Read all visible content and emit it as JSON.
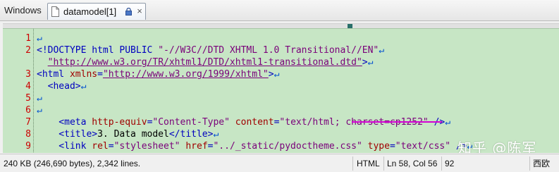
{
  "tabbar": {
    "group_label": "Windows",
    "tab": {
      "label": "datamodel[1]",
      "icon": "document-icon",
      "lock_icon": "lock-icon",
      "close_icon": "close-icon",
      "close_glyph": "×"
    }
  },
  "editor": {
    "lines": [
      {
        "number": "1",
        "tokens": []
      },
      {
        "number": "2",
        "tokens": [
          {
            "t": "<!DOCTYPE html PUBLIC ",
            "c": "tag"
          },
          {
            "t": "\"-//W3C//DTD XHTML 1.0 Transitional//EN\"",
            "c": "str"
          }
        ]
      },
      {
        "number": "",
        "tokens": [
          {
            "t": "  ",
            "c": "txt"
          },
          {
            "t": "\"http://www.w3.org/TR/xhtml1/DTD/xhtml1-transitional.dtd\"",
            "c": "str",
            "link": true
          },
          {
            "t": ">",
            "c": "tag"
          }
        ]
      },
      {
        "number": "3",
        "tokens": [
          {
            "t": "<html ",
            "c": "tag"
          },
          {
            "t": "xmlns",
            "c": "attr"
          },
          {
            "t": "=",
            "c": "tag"
          },
          {
            "t": "\"http://www.w3.org/1999/xhtml\"",
            "c": "str",
            "link": true
          },
          {
            "t": ">",
            "c": "tag"
          }
        ]
      },
      {
        "number": "4",
        "tokens": [
          {
            "t": "  <head>",
            "c": "tag"
          }
        ]
      },
      {
        "number": "5",
        "tokens": []
      },
      {
        "number": "6",
        "tokens": []
      },
      {
        "number": "7",
        "tokens": [
          {
            "t": "    <meta ",
            "c": "tag"
          },
          {
            "t": "http-equiv",
            "c": "attr"
          },
          {
            "t": "=",
            "c": "tag"
          },
          {
            "t": "\"Content-Type\"",
            "c": "str"
          },
          {
            "t": " ",
            "c": "txt"
          },
          {
            "t": "content",
            "c": "attr"
          },
          {
            "t": "=",
            "c": "tag"
          },
          {
            "t": "\"text/html; charset=cp1252\"",
            "c": "str"
          },
          {
            "t": " />",
            "c": "tag"
          }
        ]
      },
      {
        "number": "8",
        "tokens": [
          {
            "t": "    <title>",
            "c": "tag"
          },
          {
            "t": "3. Data model",
            "c": "txt"
          },
          {
            "t": "</title>",
            "c": "tag"
          }
        ]
      },
      {
        "number": "9",
        "tokens": [
          {
            "t": "    <link ",
            "c": "tag"
          },
          {
            "t": "rel",
            "c": "attr"
          },
          {
            "t": "=",
            "c": "tag"
          },
          {
            "t": "\"stylesheet\"",
            "c": "str"
          },
          {
            "t": " ",
            "c": "txt"
          },
          {
            "t": "href",
            "c": "attr"
          },
          {
            "t": "=",
            "c": "tag"
          },
          {
            "t": "\"../_static/pydoctheme.css\"",
            "c": "str"
          },
          {
            "t": " ",
            "c": "txt"
          },
          {
            "t": "type",
            "c": "attr"
          },
          {
            "t": "=",
            "c": "tag"
          },
          {
            "t": "\"text/css\"",
            "c": "str"
          },
          {
            "t": " />",
            "c": "tag"
          }
        ]
      }
    ],
    "eol_glyph": "↵",
    "highlight_color": "#d400d4",
    "background_color": "#c7e6c5"
  },
  "watermark": {
    "text": "知乎 @陈军"
  },
  "statusbar": {
    "size": "240 KB (246,690 bytes), 2,342 lines.",
    "syntax": "HTML",
    "position": "Ln 58, Col 56",
    "encoding_code": "92",
    "locale": "西欧"
  }
}
